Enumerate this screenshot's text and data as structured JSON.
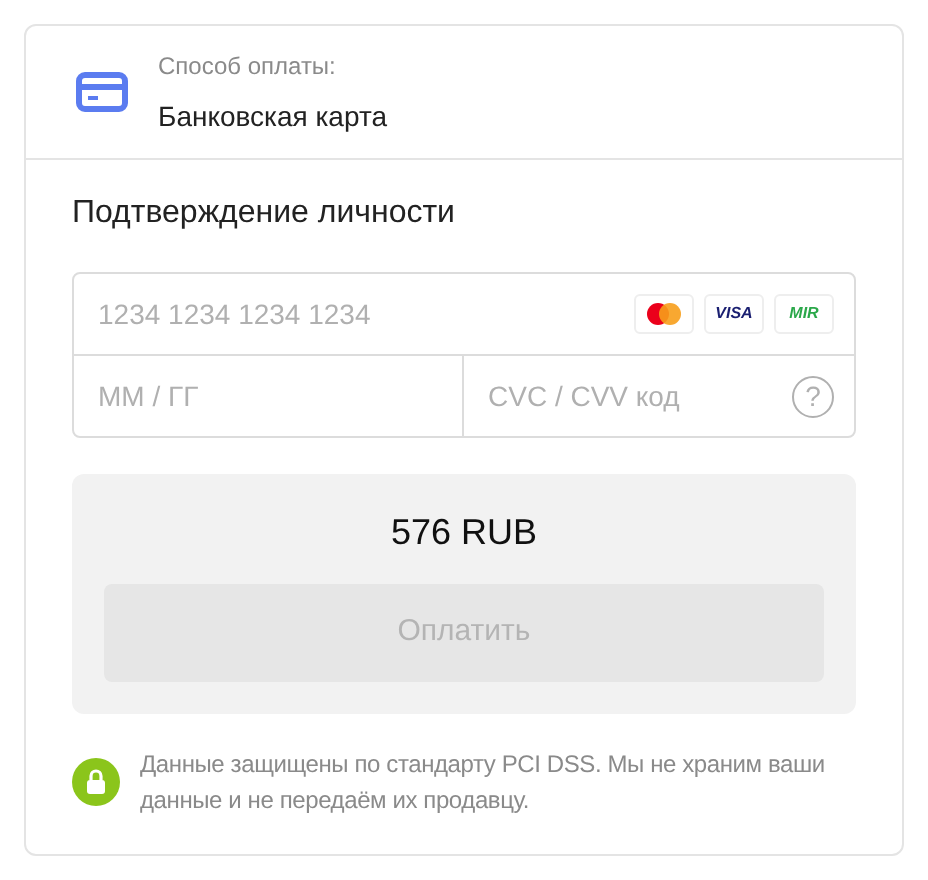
{
  "payment_method": {
    "label": "Способ оплаты:",
    "value": "Банковская карта"
  },
  "section_title": "Подтверждение личности",
  "card_form": {
    "number_placeholder": "1234 1234 1234 1234",
    "brands": [
      {
        "kind": "mastercard"
      },
      {
        "kind": "visa",
        "text": "VISA"
      },
      {
        "kind": "mir",
        "text": "MIR"
      }
    ],
    "expiry_placeholder": "ММ / ГГ",
    "cvc_placeholder": "CVC / CVV код",
    "help_text": "?"
  },
  "amount": "576 RUB",
  "pay_button": {
    "label": "Оплатить",
    "disabled": true
  },
  "security_note": "Данные защищены по стандарту PCI DSS. Мы не храним ваши данные и не передаём их продавцу."
}
